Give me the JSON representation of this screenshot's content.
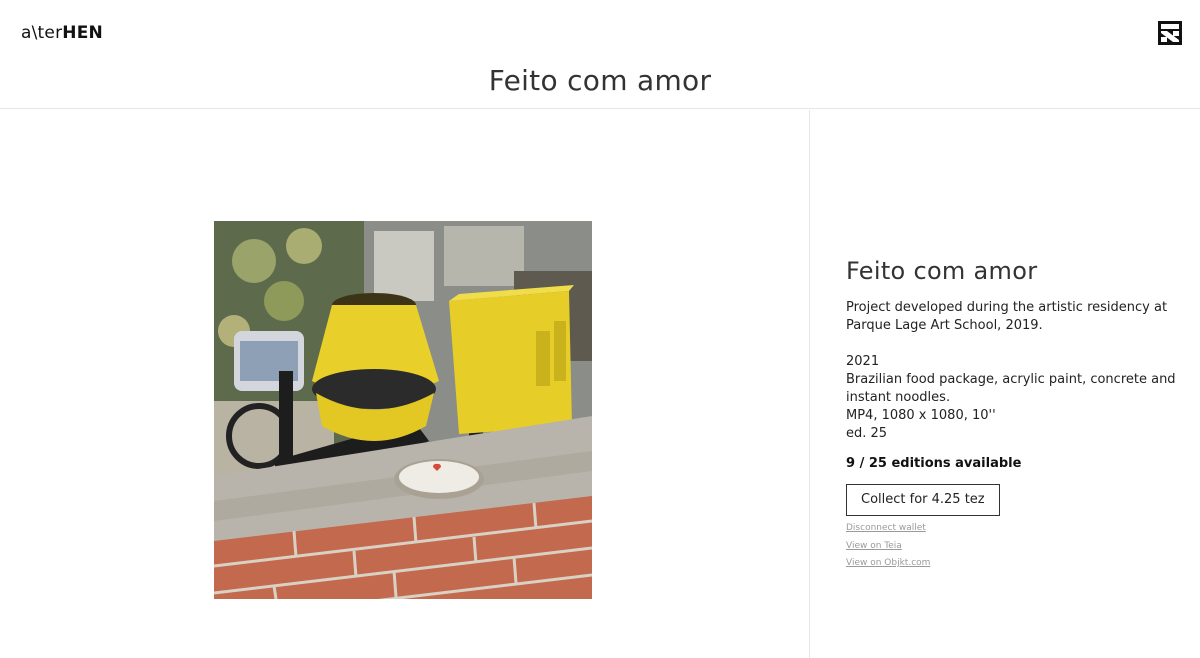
{
  "header": {
    "logo_prefix": "a\\ter",
    "logo_strong": "HEN",
    "menu_icon": "hen-logo-icon"
  },
  "page_title": "Feito com amor",
  "artwork": {
    "alt": "Feito com amor"
  },
  "info": {
    "title": "Feito com amor",
    "description": "Project developed during the artistic residency at Parque Lage Art School, 2019.",
    "year": "2021",
    "materials": "Brazilian food package, acrylic paint, concrete and instant noodles.",
    "format": "MP4, 1080 x 1080, 10''",
    "edition": "ed. 25",
    "editions_available": "9 / 25 editions available",
    "collect_label": "Collect for 4.25 tez",
    "links": {
      "disconnect": "Disconnect wallet",
      "teia": "View on Teia",
      "objkt": "View on Objkt.com"
    }
  },
  "colors": {
    "mixer_yellow": "#e8cf2a",
    "brick": "#c2694e",
    "text": "#222222",
    "link": "#9a9a9a"
  }
}
